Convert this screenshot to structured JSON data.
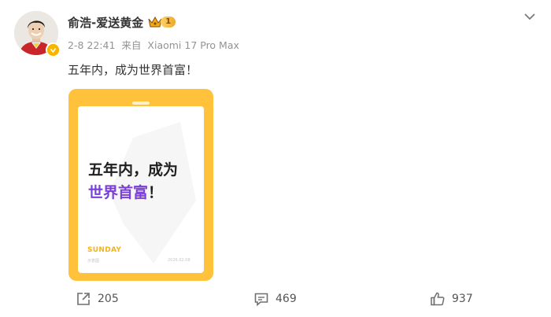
{
  "post": {
    "username": "俞浩-爱送黄金",
    "vip_level": "1",
    "date": "2-8 22:41",
    "source_prefix": "来自",
    "source_device": "Xiaomi 17 Pro Max",
    "text": "五年内，成为世界首富！"
  },
  "image": {
    "line1": "五年内，成为",
    "line2_highlight": "世界首富",
    "line2_end": "！",
    "brand": "SUNDAY",
    "subtitle": "示意图",
    "date": "2026.02.08"
  },
  "actions": {
    "repost_count": "205",
    "comment_count": "469",
    "like_count": "937"
  },
  "icons": {
    "more": "chevron-down-icon",
    "repost": "share-icon",
    "comment": "comment-icon",
    "like": "thumbs-up-icon",
    "verified": "verified-icon",
    "vip": "crown-icon"
  },
  "colors": {
    "card_frame": "#ffc23a",
    "highlight": "#7b3fd6",
    "brand": "#f5b31a",
    "verified": "#f7b500"
  }
}
